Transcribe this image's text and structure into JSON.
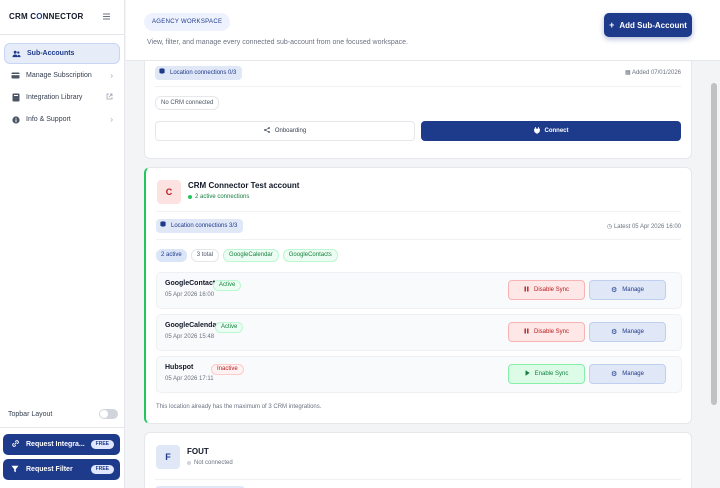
{
  "app": {
    "logo_prefix": "CRM C",
    "logo_accent": "O",
    "logo_suffix": "NNECTOR"
  },
  "sidebar": {
    "items": [
      {
        "label": "Sub-Accounts",
        "icon": "users-icon"
      },
      {
        "label": "Manage Subscription",
        "icon": "card-icon"
      },
      {
        "label": "Integration Library",
        "icon": "book-icon"
      },
      {
        "label": "Info & Support",
        "icon": "info-icon"
      }
    ],
    "topbar_layout_label": "Topbar Layout",
    "request_integration": {
      "label": "Request Integra...",
      "badge": "FREE"
    },
    "request_filter": {
      "label": "Request Filter",
      "badge": "FREE"
    }
  },
  "header": {
    "badge": "AGENCY WORKSPACE",
    "subtitle": "View, filter, and manage every connected sub-account from one focused workspace.",
    "add_button": "Add Sub-Account"
  },
  "cards": [
    {
      "location_connections": "Location connections 0/3",
      "added": "Added 07/01/2026",
      "no_crm": "No CRM connected",
      "onboarding_label": "Onboarding",
      "connect_label": "Connect"
    },
    {
      "initial": "C",
      "name": "CRM Connector Test account",
      "status_text": "2 active connections",
      "location_connections": "Location connections 3/3",
      "latest": "Latest 05 Apr 2026 16:00",
      "tags": [
        "2 active",
        "3 total",
        "GoogleCalendar",
        "GoogleContacts"
      ],
      "connections": [
        {
          "name": "GoogleContacts",
          "date": "05 Apr 2026 16:00",
          "status": "Active",
          "sync": "Disable Sync",
          "manage": "Manage"
        },
        {
          "name": "GoogleCalendar",
          "date": "05 Apr 2026 15:48",
          "status": "Active",
          "sync": "Disable Sync",
          "manage": "Manage"
        },
        {
          "name": "Hubspot",
          "date": "05 Apr 2026 17:11",
          "status": "Inactive",
          "sync": "Enable Sync",
          "manage": "Manage"
        }
      ],
      "footnote": "This location already has the maximum of 3 CRM integrations."
    },
    {
      "initial": "F",
      "name": "FOUT",
      "status_text": "Not connected"
    }
  ],
  "colors": {
    "primary": "#1e3a8a",
    "active_green": "#22c55e",
    "inactive_red": "#b91c1c"
  }
}
